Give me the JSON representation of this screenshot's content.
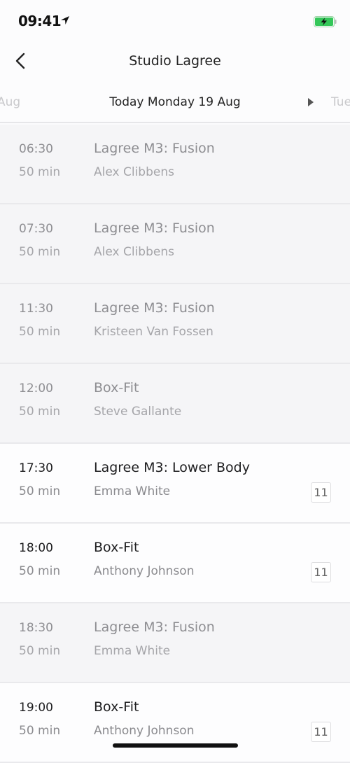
{
  "status_bar": {
    "time": "09:41",
    "location_icon": "location-arrow-icon",
    "battery_icon": "battery-charging-icon",
    "battery_color": "#34c759"
  },
  "header": {
    "back_icon": "chevron-left-icon",
    "title": "Studio Lagree"
  },
  "date_nav": {
    "prev_label": "Aug",
    "current_label": "Today Monday 19 Aug",
    "next_icon": "caret-right-icon",
    "next_label": "Tue"
  },
  "classes": [
    {
      "time": "06:30",
      "duration": "50 min",
      "name": "Lagree M3: Fusion",
      "instructor": "Alex Clibbens",
      "state": "past",
      "spots": null
    },
    {
      "time": "07:30",
      "duration": "50 min",
      "name": "Lagree M3: Fusion",
      "instructor": "Alex Clibbens",
      "state": "past",
      "spots": null
    },
    {
      "time": "11:30",
      "duration": "50 min",
      "name": "Lagree M3: Fusion",
      "instructor": "Kristeen Van Fossen",
      "state": "past",
      "spots": null
    },
    {
      "time": "12:00",
      "duration": "50 min",
      "name": "Box-Fit",
      "instructor": "Steve Gallante",
      "state": "past",
      "spots": null
    },
    {
      "time": "17:30",
      "duration": "50 min",
      "name": "Lagree M3: Lower Body",
      "instructor": "Emma White",
      "state": "open",
      "spots": "11"
    },
    {
      "time": "18:00",
      "duration": "50 min",
      "name": "Box-Fit",
      "instructor": "Anthony Johnson",
      "state": "open",
      "spots": "11"
    },
    {
      "time": "18:30",
      "duration": "50 min",
      "name": "Lagree M3: Fusion",
      "instructor": "Emma White",
      "state": "past",
      "spots": null
    },
    {
      "time": "19:00",
      "duration": "50 min",
      "name": "Box-Fit",
      "instructor": "Anthony Johnson",
      "state": "open",
      "spots": "11"
    }
  ]
}
